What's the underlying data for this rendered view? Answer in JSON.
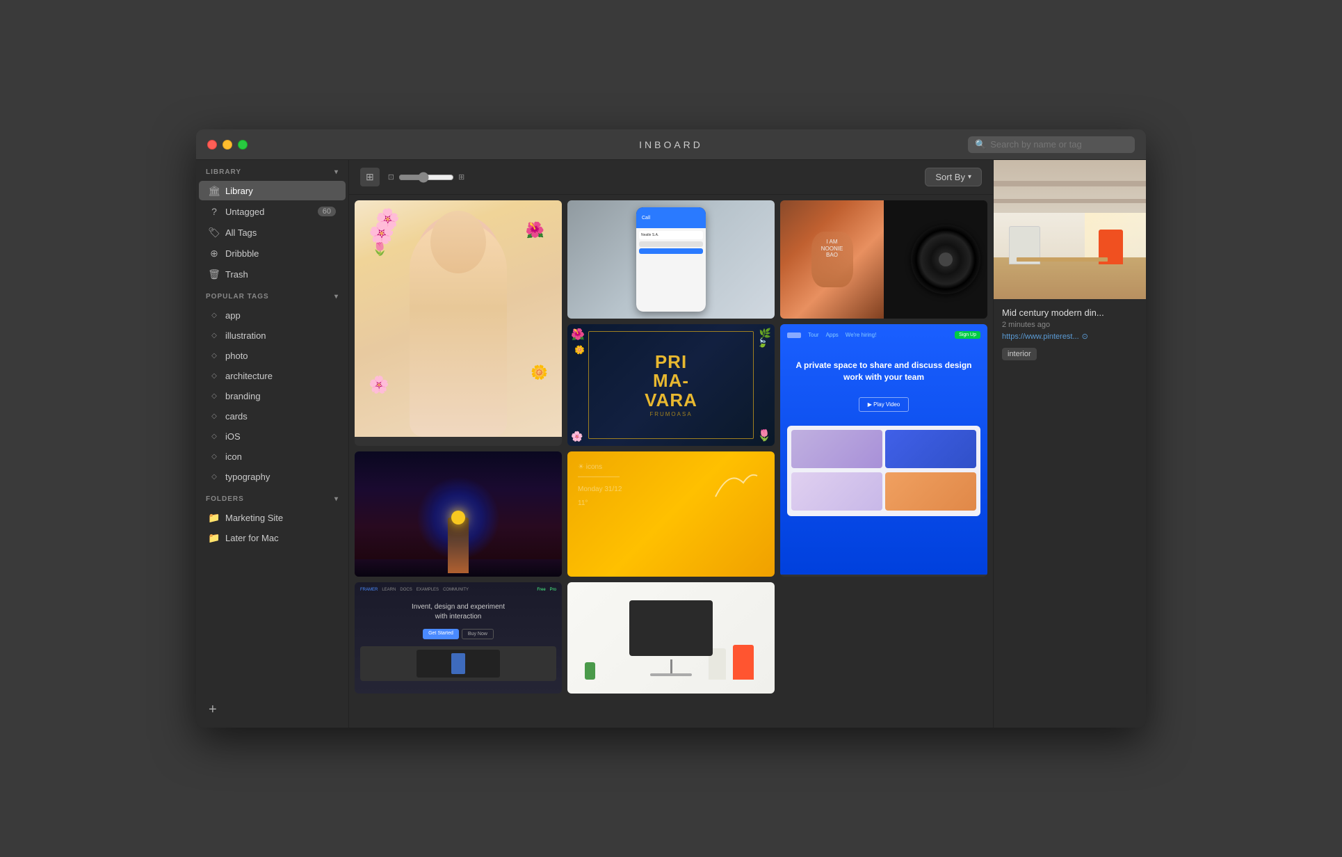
{
  "app": {
    "title": "INBOARD"
  },
  "titlebar": {
    "search_placeholder": "Search by name or tag"
  },
  "sidebar": {
    "library_header": "LIBRARY",
    "library_item": "Library",
    "untagged_label": "Untagged",
    "untagged_count": "60",
    "all_tags_label": "All Tags",
    "dribbble_label": "Dribbble",
    "trash_label": "Trash",
    "popular_tags_header": "POPULAR TAGS",
    "tags": [
      {
        "label": "app"
      },
      {
        "label": "illustration"
      },
      {
        "label": "photo"
      },
      {
        "label": "architecture"
      },
      {
        "label": "branding"
      },
      {
        "label": "cards"
      },
      {
        "label": "iOS"
      },
      {
        "label": "icon"
      },
      {
        "label": "typography"
      }
    ],
    "folders_header": "FOLDERS",
    "folders": [
      {
        "label": "Marketing Site"
      },
      {
        "label": "Later for Mac"
      }
    ],
    "add_button": "+"
  },
  "toolbar": {
    "sort_button": "Sort By"
  },
  "detail": {
    "title": "Mid century modern din...",
    "time": "2 minutes ago",
    "url": "https://www.pinterest...",
    "tags": [
      {
        "label": "interior"
      }
    ]
  }
}
